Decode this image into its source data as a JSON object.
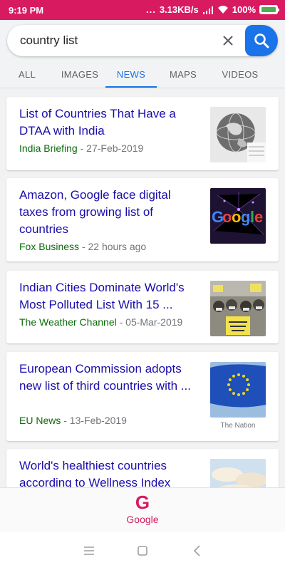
{
  "status": {
    "time": "9:19 PM",
    "dots": "...",
    "speed": "3.13KB/s",
    "battery": "100%",
    "battery_level": 1.0,
    "wifi_icon": "wifi-icon",
    "signal_icon": "signal-icon"
  },
  "search": {
    "query": "country list",
    "clear_icon": "close-icon",
    "search_icon": "search-icon"
  },
  "tabs": [
    {
      "label": "ALL"
    },
    {
      "label": "IMAGES"
    },
    {
      "label": "NEWS",
      "active": true
    },
    {
      "label": "MAPS"
    },
    {
      "label": "VIDEOS"
    }
  ],
  "results": [
    {
      "title": "List of Countries That Have a DTAA with India",
      "source": "India Briefing",
      "date": "- 27-Feb-2019"
    },
    {
      "title": "Amazon, Google face digital taxes from growing list of countries",
      "source": "Fox Business",
      "date": "- 22 hours ago"
    },
    {
      "title": "Indian Cities Dominate World's Most Polluted List With 15 ...",
      "source": "The Weather Channel",
      "date": "- 05-Mar-2019"
    },
    {
      "title": "European Commission adopts new list of third countries with ...",
      "source": "EU News",
      "date": "- 13-Feb-2019",
      "caption": "The Nation"
    },
    {
      "title": "World's healthiest countries according to Wellness Index"
    }
  ],
  "bottom": {
    "google_label": "Google",
    "logo_letter": "G"
  },
  "nav": {
    "menu_icon": "menu-icon",
    "home_icon": "home-icon",
    "back_icon": "back-icon"
  },
  "colors": {
    "status_bar": "#d81b60",
    "accent": "#1a73e8",
    "link": "#1a0dab",
    "source": "#0b6b0b"
  }
}
